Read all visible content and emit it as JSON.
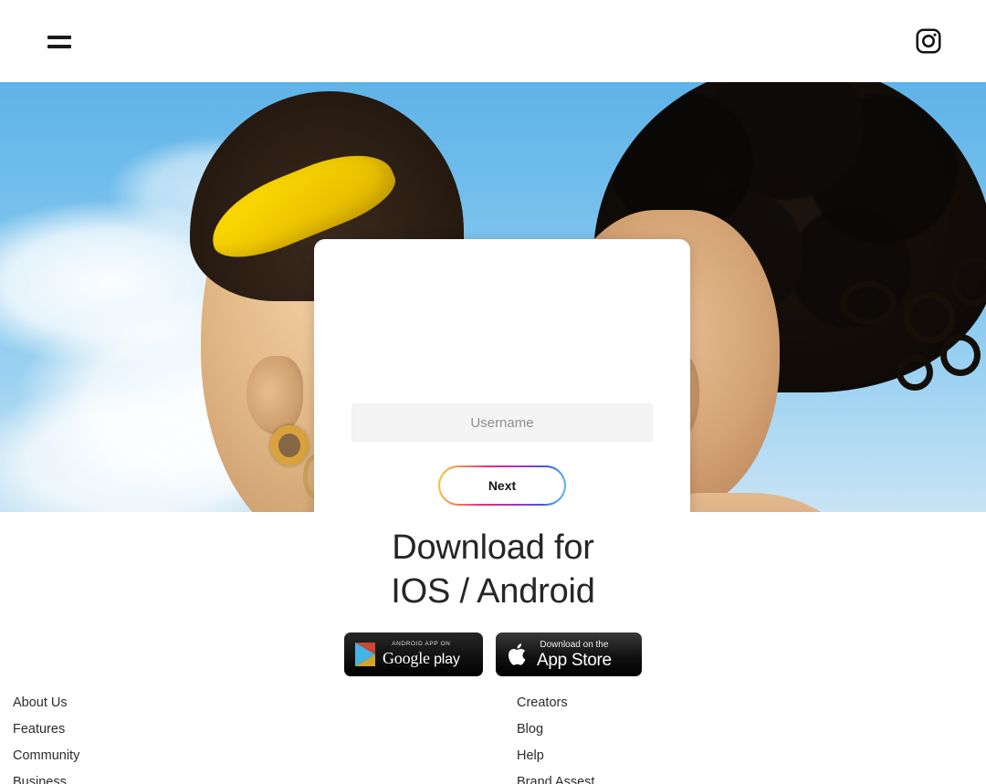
{
  "header": {
    "menu_icon": "hamburger-menu-icon",
    "brand_icon": "instagram-logo-icon"
  },
  "hero": {
    "alt": "two-people-hugging-under-blue-sky",
    "sky_color": "#74bfec",
    "headband_color": "#ffe000"
  },
  "login": {
    "username_placeholder": "Username",
    "username_value": "",
    "next_label": "Next",
    "gradient": "#f9ce34 #ee2a7b #a134c3 #3b5ce0 #59c8f2"
  },
  "download": {
    "title_line1": "Download for",
    "title_line2": "IOS / Android",
    "google_play": {
      "small": "ANDROID APP ON",
      "brand": "Google",
      "suffix": "play"
    },
    "app_store": {
      "small": "Download on the",
      "brand": "App Store"
    }
  },
  "footer": {
    "columns": [
      {
        "links": [
          "About Us",
          "Features",
          "Community",
          "Business"
        ]
      },
      {
        "links": [
          "Creators",
          "Blog",
          "Help",
          "Brand Assest"
        ]
      }
    ]
  }
}
